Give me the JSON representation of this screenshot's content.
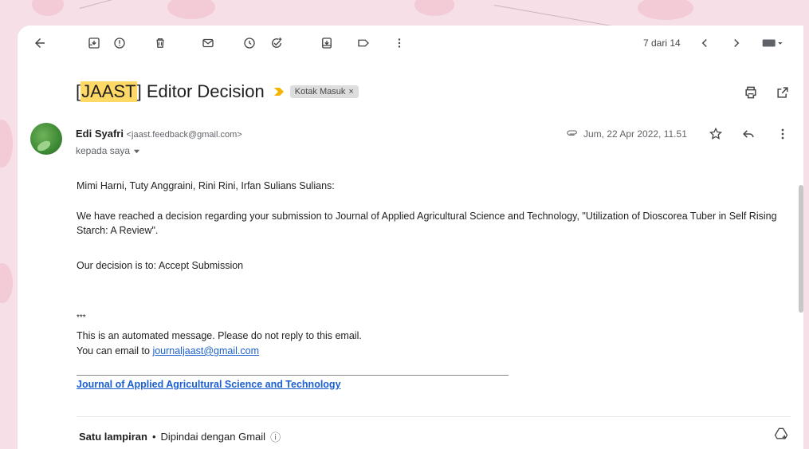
{
  "toolbar": {
    "pager_text": "7 dari 14"
  },
  "email": {
    "subject_prefix": "[",
    "subject_highlight": "JAAST",
    "subject_rest": "] Editor Decision",
    "label": "Kotak Masuk",
    "label_close": "×",
    "sender_name": "Edi Syafri",
    "sender_email": "<jaast.feedback@gmail.com>",
    "to_line": "kepada saya",
    "date": "Jum, 22 Apr 2022, 11.51",
    "greeting": "Mimi Harni, Tuty Anggraini, Rini Rini, Irfan Sulians Sulians:",
    "paragraph1": "We have reached a decision regarding your submission to Journal of Applied Agricultural Science and Technology, \"Utilization of Dioscorea Tuber in Self Rising Starch: A Review\".",
    "paragraph2": "Our decision is to: Accept Submission",
    "stars": "***",
    "auto_msg": "This is an automated message. Please do not reply to this email.",
    "contact_prefix": "You can email to ",
    "contact_email": "journaljaast@gmail.com",
    "journal_link": "Journal of Applied Agricultural Science and Technology"
  },
  "attachment": {
    "title": "Satu lampiran",
    "separator": "•",
    "scanned": "Dipindai dengan Gmail",
    "info_icon": "ⓘ"
  },
  "colors": {
    "accent_link": "#1a5fd0",
    "highlight": "#ffd966",
    "important_marker": "#f4b400"
  },
  "icons": [
    "back-arrow-icon",
    "archive-icon",
    "report-spam-icon",
    "delete-icon",
    "mark-unread-icon",
    "snooze-icon",
    "add-task-icon",
    "move-to-icon",
    "label-icon",
    "more-vert-icon",
    "chevron-left-icon",
    "chevron-right-icon",
    "keyboard-icon",
    "print-icon",
    "open-new-window-icon",
    "attachment-icon",
    "star-icon",
    "reply-icon",
    "add-to-drive-icon"
  ]
}
